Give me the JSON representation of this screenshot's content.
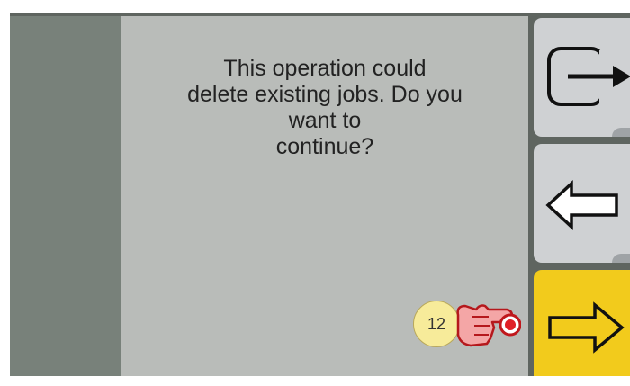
{
  "dialog": {
    "message_lines": [
      "This operation could",
      "delete existing jobs. Do you",
      "want to",
      "continue?"
    ]
  },
  "buttons": {
    "exit": {
      "icon": "exit-icon"
    },
    "back": {
      "icon": "arrow-left-icon"
    },
    "next": {
      "icon": "arrow-right-icon",
      "color": "#f2cb1c"
    }
  },
  "callout": {
    "step": "12",
    "icon": "tap-hand-icon"
  },
  "colors": {
    "panel": "#b9bcb9",
    "left_bar": "#78817a",
    "button_gray": "#cfd1d3",
    "accent_yellow": "#f2cb1c"
  }
}
